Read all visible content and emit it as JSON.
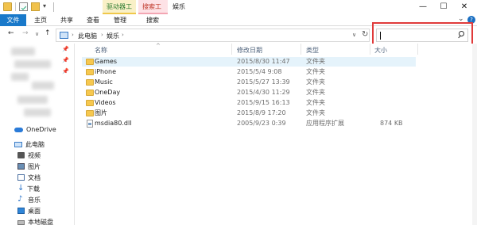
{
  "titlebar": {
    "title": "娱乐",
    "context_tab_drive": "驱动器工具",
    "context_tab_search": "搜索工具",
    "dropdown_glyph": "▾",
    "minimize": "—",
    "maximize": "☐",
    "close": "✕"
  },
  "ribbon": {
    "tabs": [
      "文件",
      "主页",
      "共享",
      "查看",
      "管理",
      "搜索"
    ],
    "expand_glyph": "⌄",
    "help_glyph": "?"
  },
  "nav": {
    "back": "←",
    "forward": "→",
    "recent": "∨",
    "up": "↑",
    "refresh": "↻",
    "address_dropdown": "∨"
  },
  "address": {
    "sep": "›",
    "segments": [
      "此电脑",
      "娱乐"
    ]
  },
  "search": {
    "placeholder": ""
  },
  "sidebar": {
    "pin_glyph": "📌",
    "onedrive": "OneDrive",
    "this_pc": "此电脑",
    "items": [
      "视频",
      "图片",
      "文档",
      "下载",
      "音乐",
      "桌面",
      "本地磁盘"
    ]
  },
  "columns": {
    "name": "名称",
    "date": "修改日期",
    "type": "类型",
    "size": "大小"
  },
  "files": [
    {
      "name": "Games",
      "date": "2015/8/30 11:47",
      "type": "文件夹",
      "size": ""
    },
    {
      "name": "iPhone",
      "date": "2015/5/4 9:08",
      "type": "文件夹",
      "size": ""
    },
    {
      "name": "Music",
      "date": "2015/5/27 13:39",
      "type": "文件夹",
      "size": ""
    },
    {
      "name": "OneDay",
      "date": "2015/4/30 11:29",
      "type": "文件夹",
      "size": ""
    },
    {
      "name": "Videos",
      "date": "2015/9/15 16:13",
      "type": "文件夹",
      "size": ""
    },
    {
      "name": "图片",
      "date": "2015/8/9 17:20",
      "type": "文件夹",
      "size": ""
    },
    {
      "name": "msdia80.dll",
      "date": "2005/9/23 0:39",
      "type": "应用程序扩展",
      "size": "874 KB"
    }
  ]
}
